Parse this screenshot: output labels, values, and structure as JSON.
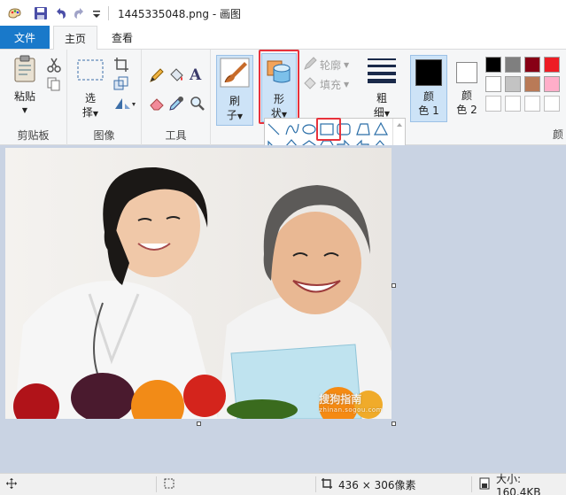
{
  "window": {
    "file_name": "1445335048.png",
    "separator": " - ",
    "app_name": "画图"
  },
  "tabs": {
    "file": "文件",
    "home": "主页",
    "view": "查看"
  },
  "ribbon": {
    "clipboard": {
      "paste": "粘贴",
      "group": "剪贴板"
    },
    "image": {
      "select_line1": "选",
      "select_line2": "择",
      "group": "图像"
    },
    "tools": {
      "group": "工具"
    },
    "brushes": {
      "line1": "刷",
      "line2": "子"
    },
    "shapes": {
      "line1": "形",
      "line2": "状"
    },
    "outline": "轮廓",
    "fill": "填充",
    "size": {
      "line1": "粗",
      "line2": "细"
    },
    "color1": {
      "line1": "颜",
      "line2": "色 1"
    },
    "color2": {
      "line1": "颜",
      "line2": "色 2"
    },
    "colors_group": "颜"
  },
  "palette": {
    "row1": [
      "#000000",
      "#7f7f7f",
      "#880015",
      "#ed1c24"
    ],
    "row2": [
      "#ffffff",
      "#c3c3c3",
      "#b97a57",
      "#ffaec9"
    ]
  },
  "colors": {
    "primary": "#000000",
    "secondary": "#ffffff",
    "accent": "#1979ca",
    "highlight": "#e8323c"
  },
  "status": {
    "dimensions": "436 × 306像素",
    "size_label": "大小: 160.4KB"
  },
  "watermark": {
    "line1": "搜狗指南",
    "line2": "zhinan.sogou.com"
  }
}
